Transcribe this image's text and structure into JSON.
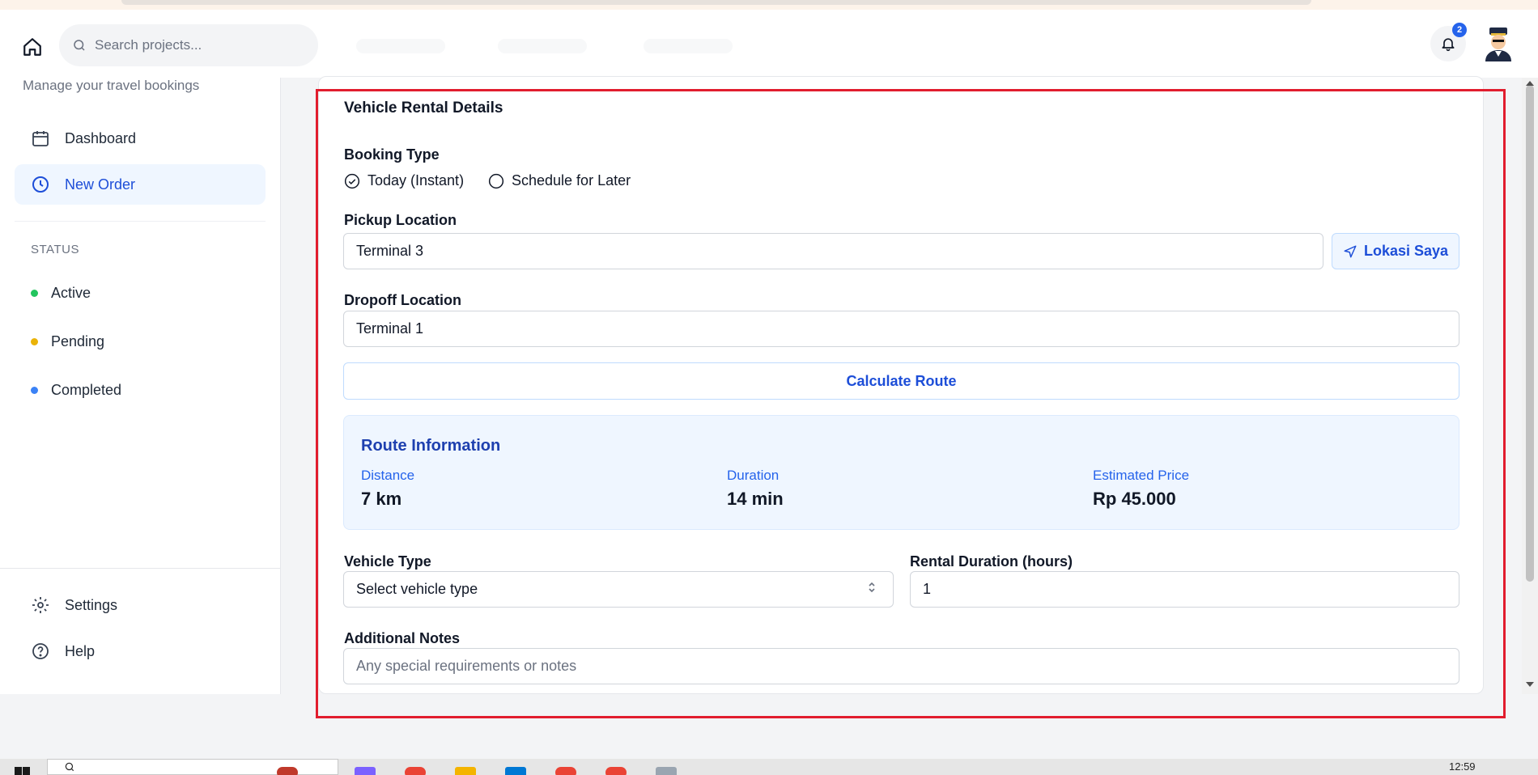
{
  "header": {
    "search_placeholder": "Search projects...",
    "notification_count": "2"
  },
  "sidebar": {
    "subtitle": "Manage your travel bookings",
    "nav": [
      {
        "label": "Dashboard",
        "icon": "calendar-icon"
      },
      {
        "label": "New Order",
        "icon": "clock-icon",
        "active": true
      }
    ],
    "status_heading": "STATUS",
    "status": [
      {
        "label": "Active",
        "color": "#22c55e"
      },
      {
        "label": "Pending",
        "color": "#eab308"
      },
      {
        "label": "Completed",
        "color": "#3b82f6"
      }
    ],
    "footer": [
      {
        "label": "Settings",
        "icon": "gear-icon"
      },
      {
        "label": "Help",
        "icon": "help-circle-icon"
      }
    ]
  },
  "form": {
    "title": "Vehicle Rental Details",
    "booking_type_label": "Booking Type",
    "booking_options": [
      {
        "label": "Today (Instant)",
        "checked": true
      },
      {
        "label": "Schedule for Later",
        "checked": false
      }
    ],
    "pickup_label": "Pickup Location",
    "pickup_value": "Terminal 3",
    "my_location_button": "Lokasi Saya",
    "dropoff_label": "Dropoff Location",
    "dropoff_value": "Terminal 1",
    "calculate_button": "Calculate Route",
    "route_info": {
      "title": "Route Information",
      "distance_label": "Distance",
      "distance_value": "7 km",
      "duration_label": "Duration",
      "duration_value": "14 min",
      "price_label": "Estimated Price",
      "price_value": "Rp 45.000"
    },
    "vehicle_type_label": "Vehicle Type",
    "vehicle_type_placeholder": "Select vehicle type",
    "rental_duration_label": "Rental Duration (hours)",
    "rental_duration_value": "1",
    "notes_label": "Additional Notes",
    "notes_placeholder": "Any special requirements or notes"
  },
  "taskbar": {
    "clock": "12:59"
  },
  "colors": {
    "accent": "#1d4ed8",
    "highlight_border": "#e11d2e",
    "route_bg": "#eff6ff"
  }
}
